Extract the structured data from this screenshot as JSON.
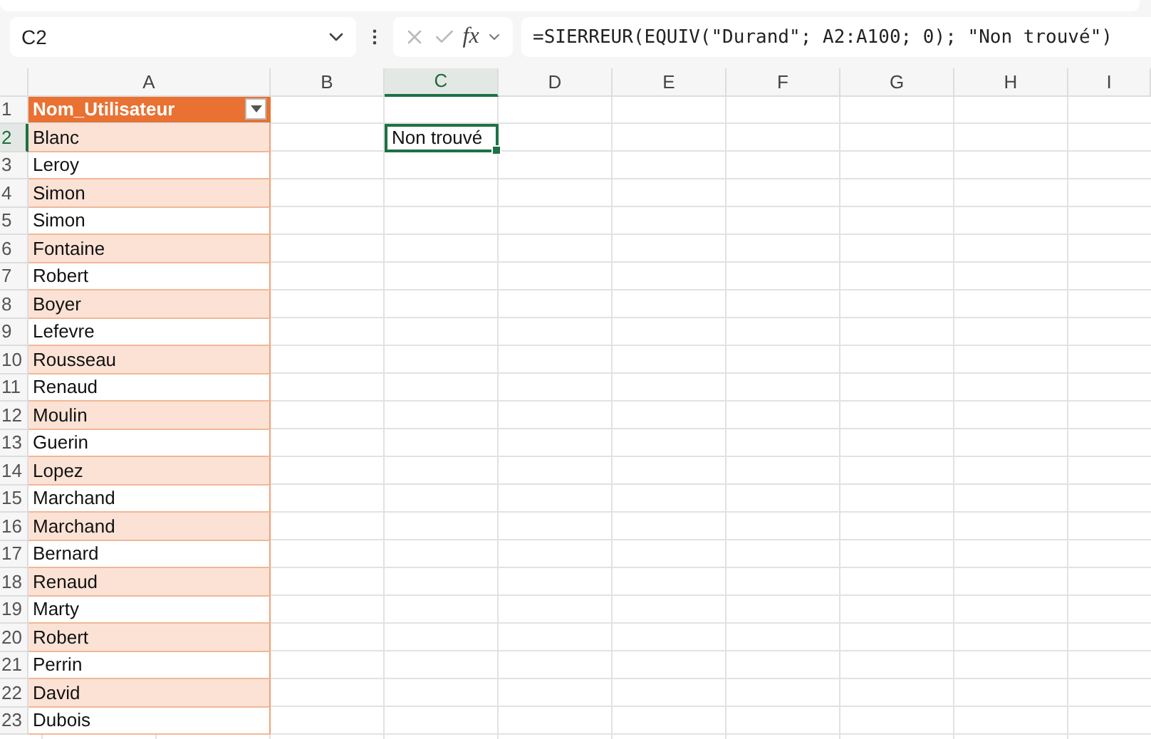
{
  "name_box": {
    "value": "C2"
  },
  "formula_bar": {
    "function_label": "fx",
    "value": "=SIERREUR(EQUIV(\"Durand\"; A2:A100; 0); \"Non trouvé\")"
  },
  "columns": [
    {
      "label": "A",
      "selected": false
    },
    {
      "label": "B",
      "selected": false
    },
    {
      "label": "C",
      "selected": true
    },
    {
      "label": "D",
      "selected": false
    },
    {
      "label": "E",
      "selected": false
    },
    {
      "label": "F",
      "selected": false
    },
    {
      "label": "G",
      "selected": false
    },
    {
      "label": "H",
      "selected": false
    },
    {
      "label": "I",
      "selected": false
    }
  ],
  "rows": [
    {
      "number": "1",
      "selected": false,
      "kind": "header",
      "value": "Nom_Utilisateur"
    },
    {
      "number": "2",
      "selected": true,
      "kind": "data",
      "value": "Blanc",
      "column_c": {
        "value": "Non trouvé",
        "selected": true
      }
    },
    {
      "number": "3",
      "selected": false,
      "kind": "data",
      "value": "Leroy"
    },
    {
      "number": "4",
      "selected": false,
      "kind": "data",
      "value": "Simon"
    },
    {
      "number": "5",
      "selected": false,
      "kind": "data",
      "value": "Simon"
    },
    {
      "number": "6",
      "selected": false,
      "kind": "data",
      "value": "Fontaine"
    },
    {
      "number": "7",
      "selected": false,
      "kind": "data",
      "value": "Robert"
    },
    {
      "number": "8",
      "selected": false,
      "kind": "data",
      "value": "Boyer"
    },
    {
      "number": "9",
      "selected": false,
      "kind": "data",
      "value": "Lefevre"
    },
    {
      "number": "10",
      "selected": false,
      "kind": "data",
      "value": "Rousseau"
    },
    {
      "number": "11",
      "selected": false,
      "kind": "data",
      "value": "Renaud"
    },
    {
      "number": "12",
      "selected": false,
      "kind": "data",
      "value": "Moulin"
    },
    {
      "number": "13",
      "selected": false,
      "kind": "data",
      "value": "Guerin"
    },
    {
      "number": "14",
      "selected": false,
      "kind": "data",
      "value": "Lopez"
    },
    {
      "number": "15",
      "selected": false,
      "kind": "data",
      "value": "Marchand"
    },
    {
      "number": "16",
      "selected": false,
      "kind": "data",
      "value": "Marchand"
    },
    {
      "number": "17",
      "selected": false,
      "kind": "data",
      "value": "Bernard"
    },
    {
      "number": "18",
      "selected": false,
      "kind": "data",
      "value": "Renaud"
    },
    {
      "number": "19",
      "selected": false,
      "kind": "data",
      "value": "Marty"
    },
    {
      "number": "20",
      "selected": false,
      "kind": "data",
      "value": "Robert"
    },
    {
      "number": "21",
      "selected": false,
      "kind": "data",
      "value": "Perrin"
    },
    {
      "number": "22",
      "selected": false,
      "kind": "data",
      "value": "David"
    },
    {
      "number": "23",
      "selected": false,
      "kind": "data",
      "value": "Dubois"
    }
  ]
}
